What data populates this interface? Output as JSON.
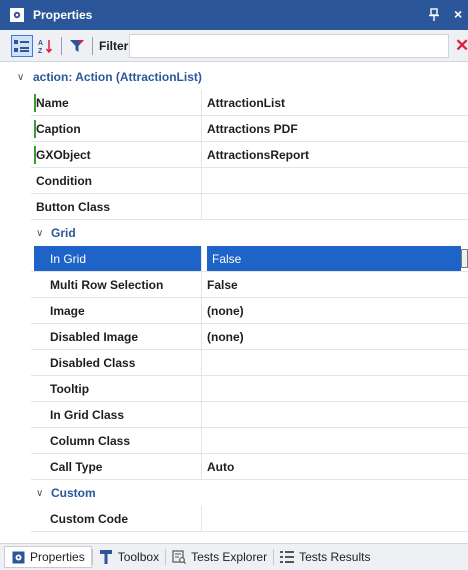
{
  "titlebar": {
    "title": "Properties",
    "icon": "gear-icon",
    "pin_icon": "pin-icon",
    "close_label": "×"
  },
  "toolbar": {
    "categorized_icon": "categorized-icon",
    "alpha_icon": "sort-alpha-icon",
    "filter_icon": "filter-icon",
    "filter_label": "Filter",
    "filter_value": "",
    "clear_label": "✕"
  },
  "category": {
    "label": "action: Action (AttractionList)"
  },
  "rows_top": [
    {
      "name": "Name",
      "value": "AttractionList",
      "marked": true
    },
    {
      "name": "Caption",
      "value": "Attractions PDF",
      "marked": true
    },
    {
      "name": "GXObject",
      "value": "AttractionsReport",
      "marked": true
    },
    {
      "name": "Condition",
      "value": ""
    },
    {
      "name": "Button Class",
      "value": ""
    }
  ],
  "group_grid": {
    "label": "Grid"
  },
  "rows_grid": [
    {
      "name": "In Grid",
      "value": "False",
      "selected": true
    },
    {
      "name": "Multi Row Selection",
      "value": "False"
    },
    {
      "name": "Image",
      "value": "(none)"
    },
    {
      "name": "Disabled Image",
      "value": "(none)"
    },
    {
      "name": "Disabled Class",
      "value": ""
    },
    {
      "name": "Tooltip",
      "value": ""
    },
    {
      "name": "In Grid Class",
      "value": ""
    },
    {
      "name": "Column Class",
      "value": ""
    },
    {
      "name": "Call Type",
      "value": "Auto"
    }
  ],
  "group_custom": {
    "label": "Custom"
  },
  "rows_custom": [
    {
      "name": "Custom Code",
      "value": ""
    }
  ],
  "tabs": [
    {
      "label": "Properties",
      "icon": "gear-icon",
      "active": true
    },
    {
      "label": "Toolbox",
      "icon": "toolbox-icon"
    },
    {
      "label": "Tests Explorer",
      "icon": "tests-explorer-icon"
    },
    {
      "label": "Tests Results",
      "icon": "tests-results-icon"
    }
  ],
  "colors": {
    "titlebar": "#2b579a",
    "selection": "#1e64c8",
    "accent": "#2b579a",
    "marker": "#3d9b35"
  }
}
